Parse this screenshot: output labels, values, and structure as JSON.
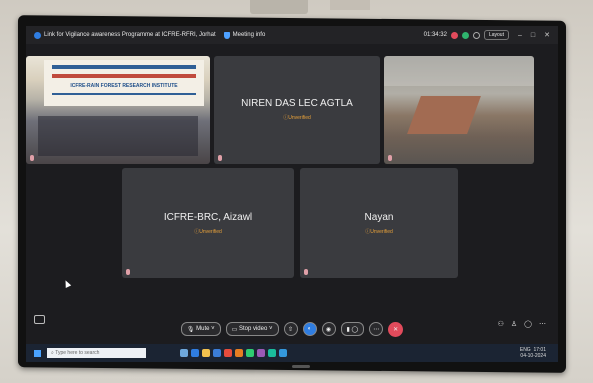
{
  "window": {
    "title": "Link for Vigilance awareness Programme at ICFRE-RFRI, Jorhat",
    "meeting_info_label": "Meeting info",
    "timer": "01:34:32",
    "layout_label": "Layout"
  },
  "tiles": [
    {
      "id": "room",
      "banner": "ICFRE-RAIN FOREST RESEARCH INSTITUTE",
      "mic_color": "#e0a0a8"
    },
    {
      "id": "niren",
      "name": "NIREN DAS LEC AGTLA",
      "status": "Unverified"
    },
    {
      "id": "conference",
      "mic_color": "#e0a0a8"
    },
    {
      "id": "brc",
      "name": "ICFRE-BRC, Aizawl",
      "status": "Unverified"
    },
    {
      "id": "nayan",
      "name": "Nayan",
      "status": "Unverified"
    }
  ],
  "toolbar": {
    "mute_label": "Mute",
    "stop_video_label": "Stop video"
  },
  "taskbar": {
    "search_placeholder": "Type here to search",
    "time": "17:01",
    "date": "04-10-2024",
    "lang": "ENG"
  },
  "colors": {
    "screen_bg": "#1c1c1f",
    "tile_bg": "#3a3b3f",
    "unverified": "#e6a03a",
    "end_call": "#e24b5c",
    "taskbar_bg": "#1b2433"
  }
}
